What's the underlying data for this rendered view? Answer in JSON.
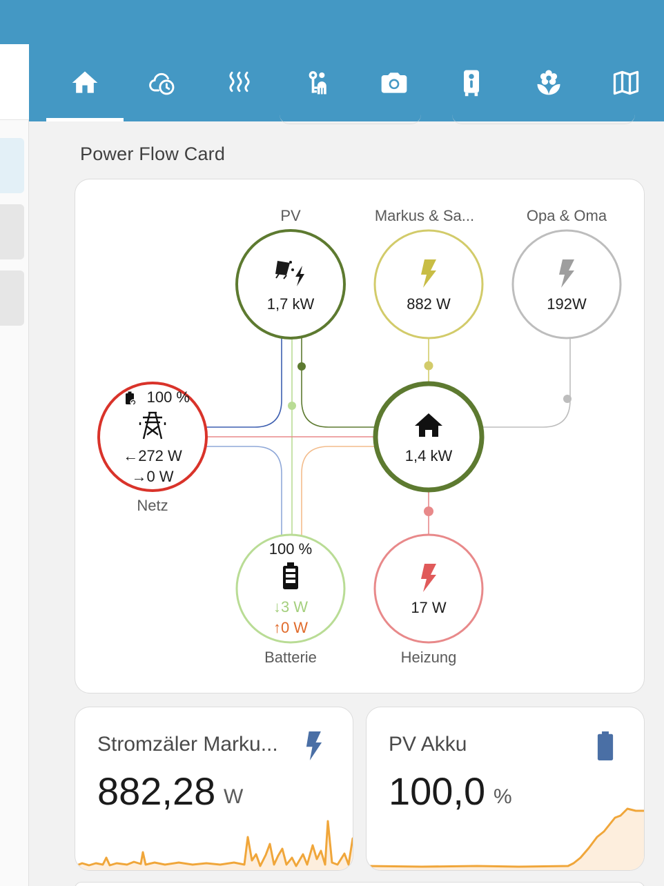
{
  "nav": {
    "tabs": [
      {
        "name": "tab-home",
        "icon": "home-icon",
        "active": true
      },
      {
        "name": "tab-weather",
        "icon": "cloud-clock-icon",
        "active": false
      },
      {
        "name": "tab-heating",
        "icon": "heat-waves-icon",
        "active": false
      },
      {
        "name": "tab-access",
        "icon": "key-person-icon",
        "active": false
      },
      {
        "name": "tab-cameras",
        "icon": "camera-icon",
        "active": false
      },
      {
        "name": "tab-doorbell",
        "icon": "doorbell-icon",
        "active": false
      },
      {
        "name": "tab-garden",
        "icon": "flower-icon",
        "active": false
      },
      {
        "name": "tab-map",
        "icon": "map-icon",
        "active": false
      }
    ]
  },
  "section_title": "Power Flow Card",
  "power_flow": {
    "pv": {
      "label": "PV",
      "value": "1,7 kW",
      "color": "#5d7a30"
    },
    "individual1": {
      "label": "Markus & Sa...",
      "value": "882 W",
      "color": "#d2cb6a"
    },
    "individual2": {
      "label": "Opa & Oma",
      "value": "192W",
      "color": "#bdbdbd"
    },
    "grid": {
      "label": "Netz",
      "soc": "100 %",
      "import": "272 W",
      "export": "0 W",
      "color": "#d9332a",
      "import_arrow": "←",
      "export_arrow": "→"
    },
    "home": {
      "value": "1,4 kW",
      "color": "#5d7a30"
    },
    "battery": {
      "label": "Batterie",
      "soc": "100 %",
      "in": "3 W",
      "out": "0 W",
      "in_arrow": "↓",
      "out_arrow": "↑",
      "color": "#b9dc95"
    },
    "heating": {
      "label": "Heizung",
      "value": "17 W",
      "color": "#e8898a"
    }
  },
  "sensors": [
    {
      "title": "Stromzäler Marku...",
      "value": "882,28",
      "unit": "W",
      "icon": "flash-icon",
      "icon_color": "#4a6fa5"
    },
    {
      "title": "PV Akku",
      "value": "100,0",
      "unit": "%",
      "icon": "battery-icon",
      "icon_color": "#4a6fa5"
    }
  ],
  "colors": {
    "header": "#4498c4",
    "sparkline": "#f0a63a",
    "sparkline_fill": "#fdeedd"
  }
}
